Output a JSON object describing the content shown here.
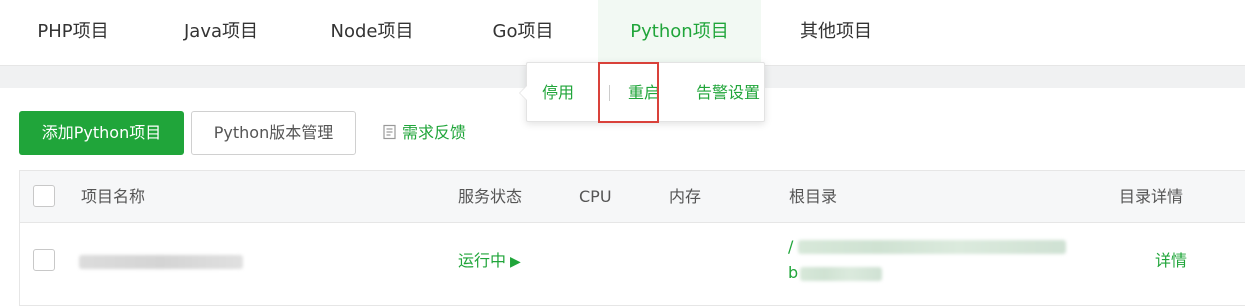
{
  "tabs": [
    {
      "label": "PHP项目"
    },
    {
      "label": "Java项目"
    },
    {
      "label": "Node项目"
    },
    {
      "label": "Go项目"
    },
    {
      "label": "Python项目",
      "active": true
    },
    {
      "label": "其他项目"
    }
  ],
  "toolbar": {
    "add_label": "添加Python项目",
    "version_label": "Python版本管理",
    "feedback_label": "需求反馈"
  },
  "table": {
    "headers": {
      "name": "项目名称",
      "status": "服务状态",
      "cpu": "CPU",
      "memory": "内存",
      "root": "根目录",
      "detail": "目录详情"
    },
    "rows": [
      {
        "status": "运行中",
        "root_prefix_1": "/",
        "root_prefix_2": "b",
        "detail": "详情"
      }
    ]
  },
  "popover": {
    "stop": "停用",
    "restart": "重启",
    "alarm": "告警设置"
  },
  "colors": {
    "accent": "#20a53a",
    "highlight": "#d9413a"
  }
}
